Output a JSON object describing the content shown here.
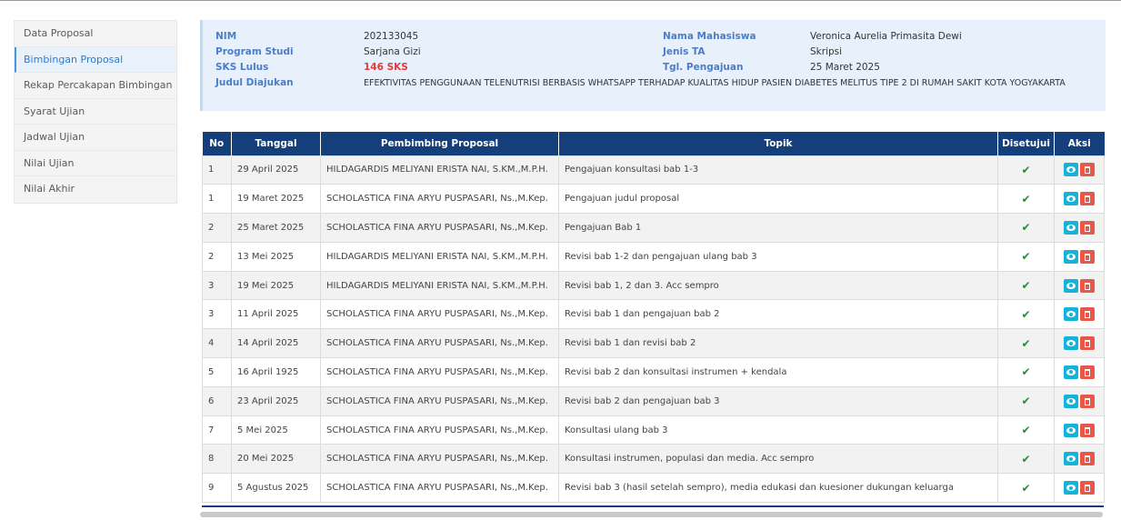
{
  "sidebar": {
    "items": [
      {
        "label": "Data Proposal",
        "active": false
      },
      {
        "label": "Bimbingan Proposal",
        "active": true
      },
      {
        "label": "Rekap Percakapan Bimbingan",
        "active": false
      },
      {
        "label": "Syarat Ujian",
        "active": false
      },
      {
        "label": "Jadwal Ujian",
        "active": false
      },
      {
        "label": "Nilai Ujian",
        "active": false
      },
      {
        "label": "Nilai Akhir",
        "active": false
      }
    ]
  },
  "info": {
    "nim_label": "NIM",
    "nim": "202133045",
    "prodi_label": "Program Studi",
    "prodi": "Sarjana Gizi",
    "sks_label": "SKS Lulus",
    "sks": "146 SKS",
    "judul_label": "Judul Diajukan",
    "judul": "EFEKTIVITAS PENGGUNAAN TELENUTRISI BERBASIS WHATSAPP TERHADAP KUALITAS HIDUP PASIEN DIABETES MELITUS TIPE 2 DI RUMAH SAKIT KOTA YOGYAKARTA",
    "nama_label": "Nama Mahasiswa",
    "nama": "Veronica Aurelia Primasita Dewi",
    "jenis_label": "Jenis TA",
    "jenis": "Skripsi",
    "tgl_label": "Tgl. Pengajuan",
    "tgl": "25 Maret 2025"
  },
  "table": {
    "headers": {
      "no": "No",
      "tanggal": "Tanggal",
      "pembimbing": "Pembimbing Proposal",
      "topik": "Topik",
      "disetujui": "Disetujui",
      "aksi": "Aksi"
    },
    "rows": [
      {
        "no": "1",
        "tanggal": "29 April 2025",
        "pembimbing": "HILDAGARDIS MELIYANI ERISTA NAI, S.KM.,M.P.H.",
        "topik": "Pengajuan konsultasi bab 1-3",
        "disetujui": "✔"
      },
      {
        "no": "1",
        "tanggal": "19 Maret 2025",
        "pembimbing": "SCHOLASTICA FINA ARYU PUSPASARI, Ns.,M.Kep.",
        "topik": "Pengajuan judul proposal",
        "disetujui": "✔"
      },
      {
        "no": "2",
        "tanggal": "25 Maret 2025",
        "pembimbing": "SCHOLASTICA FINA ARYU PUSPASARI, Ns.,M.Kep.",
        "topik": "Pengajuan Bab 1",
        "disetujui": "✔"
      },
      {
        "no": "2",
        "tanggal": "13 Mei 2025",
        "pembimbing": "HILDAGARDIS MELIYANI ERISTA NAI, S.KM.,M.P.H.",
        "topik": "Revisi bab 1-2 dan pengajuan ulang bab 3",
        "disetujui": "✔"
      },
      {
        "no": "3",
        "tanggal": "19 Mei 2025",
        "pembimbing": "HILDAGARDIS MELIYANI ERISTA NAI, S.KM.,M.P.H.",
        "topik": "Revisi bab 1, 2 dan 3. Acc sempro",
        "disetujui": "✔"
      },
      {
        "no": "3",
        "tanggal": "11 April 2025",
        "pembimbing": "SCHOLASTICA FINA ARYU PUSPASARI, Ns.,M.Kep.",
        "topik": "Revisi bab 1 dan pengajuan bab 2",
        "disetujui": "✔"
      },
      {
        "no": "4",
        "tanggal": "14 April 2025",
        "pembimbing": "SCHOLASTICA FINA ARYU PUSPASARI, Ns.,M.Kep.",
        "topik": "Revisi bab 1 dan revisi bab 2",
        "disetujui": "✔"
      },
      {
        "no": "5",
        "tanggal": "16 April 1925",
        "pembimbing": "SCHOLASTICA FINA ARYU PUSPASARI, Ns.,M.Kep.",
        "topik": "Revisi bab 2 dan konsultasi instrumen + kendala",
        "disetujui": "✔"
      },
      {
        "no": "6",
        "tanggal": "23 April 2025",
        "pembimbing": "SCHOLASTICA FINA ARYU PUSPASARI, Ns.,M.Kep.",
        "topik": "Revisi bab 2 dan pengajuan bab 3",
        "disetujui": "✔"
      },
      {
        "no": "7",
        "tanggal": "5 Mei 2025",
        "pembimbing": "SCHOLASTICA FINA ARYU PUSPASARI, Ns.,M.Kep.",
        "topik": "Konsultasi ulang bab 3",
        "disetujui": "✔"
      },
      {
        "no": "8",
        "tanggal": "20 Mei 2025",
        "pembimbing": "SCHOLASTICA FINA ARYU PUSPASARI, Ns.,M.Kep.",
        "topik": "Konsultasi instrumen, populasi dan media. Acc sempro",
        "disetujui": "✔"
      },
      {
        "no": "9",
        "tanggal": "5 Agustus 2025",
        "pembimbing": "SCHOLASTICA FINA ARYU PUSPASARI, Ns.,M.Kep.",
        "topik": "Revisi bab 3 (hasil setelah sempro), media edukasi dan kuesioner dukungan keluarga",
        "disetujui": "✔"
      }
    ]
  },
  "icons": {
    "view": "eye-icon",
    "delete": "trash-icon",
    "approved": "check-icon"
  },
  "colors": {
    "header_bg": "#143f7a",
    "view_button": "#15b3d9",
    "delete_button": "#e8584a",
    "approved_check": "#1f8f3a",
    "sks_value": "#e03a3a"
  }
}
